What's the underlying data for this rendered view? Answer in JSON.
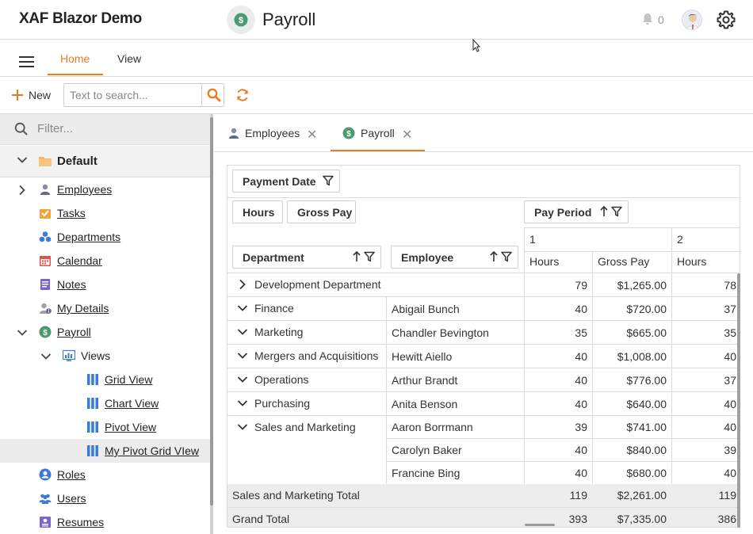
{
  "header": {
    "app_title": "XAF Blazor Demo",
    "page_title": "Payroll",
    "notification_count": "0"
  },
  "ribbon": {
    "tabs": [
      {
        "label": "Home",
        "active": true
      },
      {
        "label": "View",
        "active": false
      }
    ]
  },
  "toolbar": {
    "new_label": "New",
    "search_placeholder": "Text to search..."
  },
  "sidebar": {
    "filter_placeholder": "Filter...",
    "group_label": "Default",
    "items": [
      {
        "label": "Employees",
        "icon": "employee-icon"
      },
      {
        "label": "Tasks",
        "icon": "tasks-icon"
      },
      {
        "label": "Departments",
        "icon": "departments-icon"
      },
      {
        "label": "Calendar",
        "icon": "calendar-icon"
      },
      {
        "label": "Notes",
        "icon": "notes-icon"
      },
      {
        "label": "My Details",
        "icon": "my-details-icon"
      },
      {
        "label": "Payroll",
        "icon": "payroll-icon"
      },
      {
        "label": "Views",
        "icon": "views-icon"
      },
      {
        "label": "Grid View",
        "icon": "grid-view-icon"
      },
      {
        "label": "Chart View",
        "icon": "chart-view-icon"
      },
      {
        "label": "Pivot View",
        "icon": "pivot-view-icon"
      },
      {
        "label": "My Pivot Grid VIew",
        "icon": "pivot-view-icon"
      },
      {
        "label": "Roles",
        "icon": "roles-icon"
      },
      {
        "label": "Users",
        "icon": "users-icon"
      },
      {
        "label": "Resumes",
        "icon": "resumes-icon"
      }
    ]
  },
  "content_tabs": [
    {
      "label": "Employees",
      "active": false
    },
    {
      "label": "Payroll",
      "active": true
    }
  ],
  "pivot": {
    "filter_field": "Payment Date",
    "data_fields": [
      "Hours",
      "Gross Pay"
    ],
    "column_field": "Pay Period",
    "row_fields": [
      "Department",
      "Employee"
    ],
    "column_values": [
      "1",
      "2"
    ],
    "measure_headers": [
      "Hours",
      "Gross Pay",
      "Hours"
    ],
    "rows": [
      {
        "department": "Development Department",
        "employee": "",
        "hours1": "79",
        "pay1": "$1,265.00",
        "hours2": "78"
      },
      {
        "department": "Finance",
        "employee": "Abigail Bunch",
        "hours1": "40",
        "pay1": "$720.00",
        "hours2": "37"
      },
      {
        "department": "Marketing",
        "employee": "Chandler Bevington",
        "hours1": "35",
        "pay1": "$665.00",
        "hours2": "35"
      },
      {
        "department": "Mergers and Acquisitions",
        "employee": "Hewitt Aiello",
        "hours1": "40",
        "pay1": "$1,008.00",
        "hours2": "40"
      },
      {
        "department": "Operations",
        "employee": "Arthur Brandt",
        "hours1": "40",
        "pay1": "$776.00",
        "hours2": "37"
      },
      {
        "department": "Purchasing",
        "employee": "Anita Benson",
        "hours1": "40",
        "pay1": "$640.00",
        "hours2": "40"
      },
      {
        "department": "Sales and Marketing",
        "employee": "Aaron Borrmann",
        "hours1": "39",
        "pay1": "$741.00",
        "hours2": "40"
      },
      {
        "department": "",
        "employee": "Carolyn Baker",
        "hours1": "40",
        "pay1": "$840.00",
        "hours2": "39"
      },
      {
        "department": "",
        "employee": "Francine Bing",
        "hours1": "40",
        "pay1": "$680.00",
        "hours2": "40"
      }
    ],
    "subtotal": {
      "label": "Sales and Marketing Total",
      "hours1": "119",
      "pay1": "$2,261.00",
      "hours2": "119"
    },
    "grand_total": {
      "label": "Grand Total",
      "hours1": "393",
      "pay1": "$7,335.00",
      "hours2": "386"
    }
  },
  "colors": {
    "accent": "#e67e22",
    "payroll_green": "#4a9b6e"
  }
}
